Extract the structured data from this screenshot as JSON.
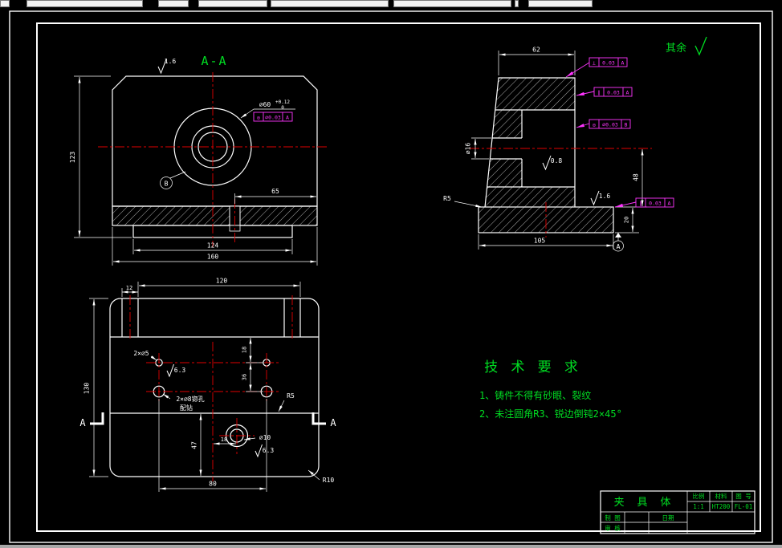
{
  "drawing": {
    "section_label": "A-A",
    "surplus_label": "其余",
    "front_view": {
      "dim_height": "123",
      "dim_slot": "65",
      "dim_flange": "124",
      "dim_base": "160",
      "roughness_top": "1.6",
      "hole_label": "⌀60",
      "hole_tol_upper": "+0.12",
      "hole_tol_lower": "0",
      "geo_frame": {
        "symbol": "◎",
        "value": "⌀0.03",
        "datum": "A"
      },
      "datum_b": "B"
    },
    "side_view": {
      "dim_top": "62",
      "dim_hole": "⌀16",
      "dim_right": "48",
      "dim_base_height": "20",
      "dim_base": "105",
      "fillet": "R5",
      "rough_bore": "0.8",
      "rough_face": "1.6",
      "datum_a": "A",
      "frames": [
        {
          "symbol": "⊥",
          "value": "0.03",
          "datum": "A"
        },
        {
          "symbol": "∥",
          "value": "0.03",
          "datum": "A"
        },
        {
          "symbol": "◎",
          "value": "⌀0.03",
          "datum": "B"
        },
        {
          "symbol": "∥",
          "value": "0.03",
          "datum": "A"
        }
      ]
    },
    "top_view": {
      "dim_width": "120",
      "dim_notch": "12",
      "dim_depth": "130",
      "holes_small": "2×⌀5",
      "rough_small": "6.3",
      "holes_spotface": "2×⌀8锪孔",
      "spotface_note": "配钻",
      "dim_row1": "18",
      "dim_row2": "36",
      "dim_step": "47",
      "dim_hole_offset": "18",
      "hole_center": "⌀10",
      "rough_center": "6.3",
      "dim_holes_span": "80",
      "corner_radius": "R10",
      "step_radius": "R5",
      "section_left": "A",
      "section_right": "A"
    },
    "tech": {
      "title": "技 术 要 求",
      "items": [
        "1、铸件不得有砂眼、裂纹",
        "2、未注圆角R3、锐边倒钝2×45°"
      ]
    },
    "title_block": {
      "part_name": "夹 具 体",
      "scale_label": "比例",
      "material_label": "材料",
      "number_label": "图 号",
      "scale": "1:1",
      "material": "HT200",
      "number": "FL-01",
      "drafter_label": "制 图",
      "checker_label": "审 核",
      "date_label": "日期"
    }
  }
}
